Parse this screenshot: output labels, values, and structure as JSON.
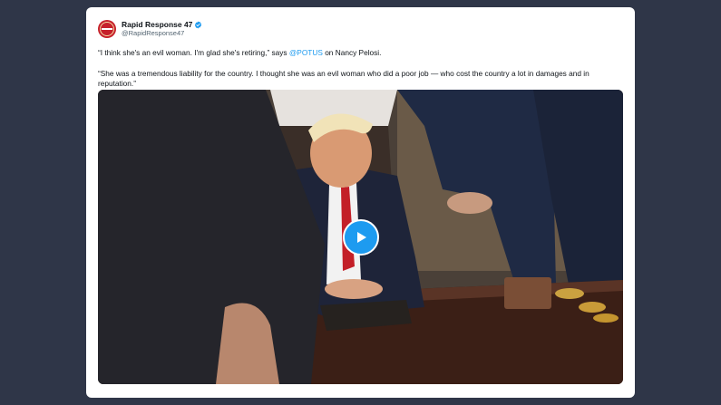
{
  "tweet": {
    "author": {
      "display_name": "Rapid Response 47",
      "handle": "@RapidResponse47",
      "verified": true,
      "avatar_icon": "presidential-seal-avatar"
    },
    "paragraph1": {
      "before": "“I think she's an evil woman. I'm glad she's retiring,” says ",
      "mention": "@POTUS",
      "after": " on Nancy Pelosi."
    },
    "paragraph2": "“She was a tremendous liability for the country. I thought she was an evil woman who did a poor job — who cost the country a lot in damages and in reputation.”",
    "media": {
      "type": "video",
      "play_icon": "play-icon"
    }
  },
  "colors": {
    "page_background": "#2f3648",
    "card_background": "#ffffff",
    "accent": "#1d9bf0",
    "text": "#0f1419",
    "secondary_text": "#536471"
  }
}
